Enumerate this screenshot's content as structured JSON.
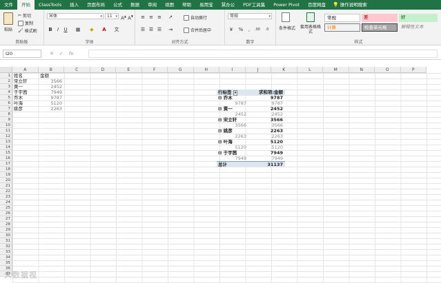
{
  "menu": {
    "tabs": [
      "文件",
      "开始",
      "ClassTools",
      "插入",
      "页面布局",
      "公式",
      "数据",
      "审阅",
      "视图",
      "帮助",
      "易用宝",
      "慧办公",
      "PDF工具集",
      "Power Pivot",
      "百度网盘"
    ],
    "active": "开始",
    "tell_me": "操作说明搜索"
  },
  "ribbon": {
    "clipboard": {
      "label": "剪贴板",
      "paste": "粘贴",
      "cut": "剪切",
      "copy": "复制",
      "painter": "格式刷"
    },
    "font": {
      "label": "字体",
      "name": "宋体",
      "size": "11",
      "bold": "B",
      "italic": "I",
      "underline": "U"
    },
    "align": {
      "label": "对齐方式",
      "wrap": "自动换行",
      "merge": "合并后居中"
    },
    "number": {
      "label": "数字",
      "format": "常规"
    },
    "styles": {
      "label": "样式",
      "cond_format": "条件格式",
      "table_format": "套用表格格式",
      "cells": [
        "常规",
        "差",
        "好",
        "计算",
        "检查单元格",
        "解释性文本"
      ]
    }
  },
  "formula": {
    "namebox": "I20",
    "fx": "fx",
    "value": ""
  },
  "sheet": {
    "columns": [
      "A",
      "B",
      "C",
      "D",
      "E",
      "F",
      "G",
      "H",
      "I",
      "J",
      "K",
      "L",
      "M",
      "N",
      "O",
      "P"
    ],
    "rows": [
      "1",
      "2",
      "3",
      "4",
      "5",
      "6",
      "7",
      "8",
      "9",
      "10",
      "11",
      "12",
      "13",
      "14",
      "15",
      "16",
      "17",
      "18",
      "19",
      "20",
      "21",
      "22",
      "23",
      "24",
      "25",
      "26",
      "27",
      "28",
      "29",
      "30",
      "31",
      "32",
      "33",
      "34",
      "35",
      "36",
      "37"
    ],
    "source": {
      "headers": [
        "姓名",
        "金额"
      ],
      "rows": [
        [
          "宋立轩",
          "3566"
        ],
        [
          "黄一",
          "2452"
        ],
        [
          "于宇茜",
          "7949"
        ],
        [
          "乔木",
          "9787"
        ],
        [
          "叶海",
          "5120"
        ],
        [
          "姚彦",
          "2263"
        ]
      ]
    },
    "pivot": {
      "header": [
        "行标签",
        "求和项:金额"
      ],
      "groups": [
        {
          "name": "乔木",
          "sum": "9787",
          "detail": "9787",
          "detail_sum": "9787"
        },
        {
          "name": "黄一",
          "sum": "2452",
          "detail": "2452",
          "detail_sum": "2452"
        },
        {
          "name": "宋立轩",
          "sum": "3566",
          "detail": "3566",
          "detail_sum": "3566"
        },
        {
          "name": "姚彦",
          "sum": "2263",
          "detail": "2263",
          "detail_sum": "2263"
        },
        {
          "name": "叶海",
          "sum": "5120",
          "detail": "5120",
          "detail_sum": "5120"
        },
        {
          "name": "于宇茜",
          "sum": "7949",
          "detail": "7949",
          "detail_sum": "7949"
        }
      ],
      "total_label": "总计",
      "total": "31137"
    }
  },
  "watermark": "大数据视",
  "colors": {
    "accent": "#217346",
    "pivot_header": "#dce6f1"
  }
}
